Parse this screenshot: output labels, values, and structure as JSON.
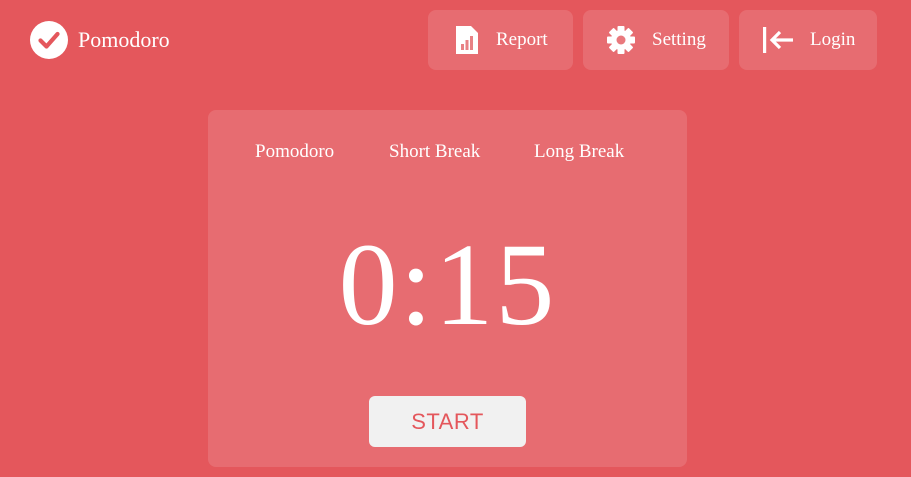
{
  "app": {
    "title": "Pomodoro",
    "logo_icon": "check-circle-icon"
  },
  "nav": {
    "report": {
      "label": "Report",
      "icon": "report-icon"
    },
    "setting": {
      "label": "Setting",
      "icon": "gear-icon"
    },
    "login": {
      "label": "Login",
      "icon": "login-icon"
    }
  },
  "timer": {
    "modes": [
      "Pomodoro",
      "Short Break",
      "Long Break"
    ],
    "display": "0:15",
    "start_label": "START"
  },
  "colors": {
    "background": "#e4575c",
    "card": "rgba(255,255,255,0.13)",
    "text": "#ffffff",
    "start_button_bg": "#f1f1f1",
    "start_button_text": "#e4575c"
  }
}
